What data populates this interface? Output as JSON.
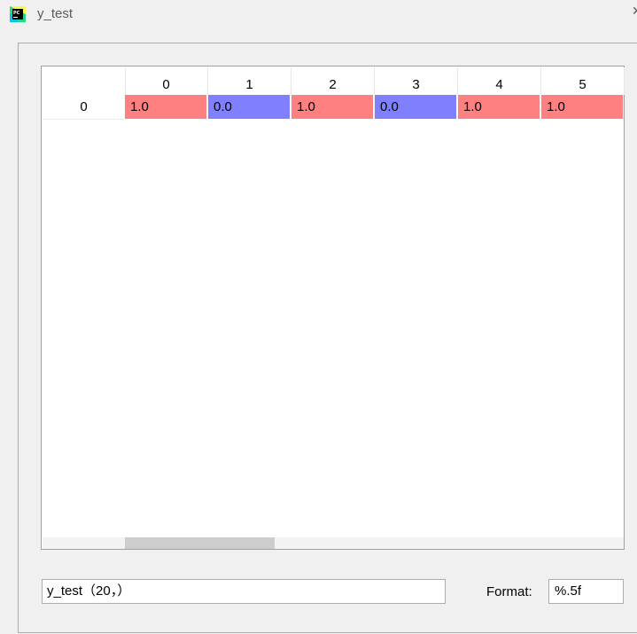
{
  "window": {
    "title": "y_test",
    "app_icon": "pycharm-icon"
  },
  "colors": {
    "high": "#ff8080",
    "low": "#8080ff"
  },
  "table": {
    "columns": [
      "0",
      "1",
      "2",
      "3",
      "4",
      "5"
    ],
    "rows": [
      {
        "label": "0",
        "cells": [
          "1.0",
          "0.0",
          "1.0",
          "0.0",
          "1.0",
          "1.0"
        ]
      }
    ]
  },
  "footer": {
    "name_value": "y_test（20，）",
    "format_label": "Format:",
    "format_value": "%.5f"
  }
}
